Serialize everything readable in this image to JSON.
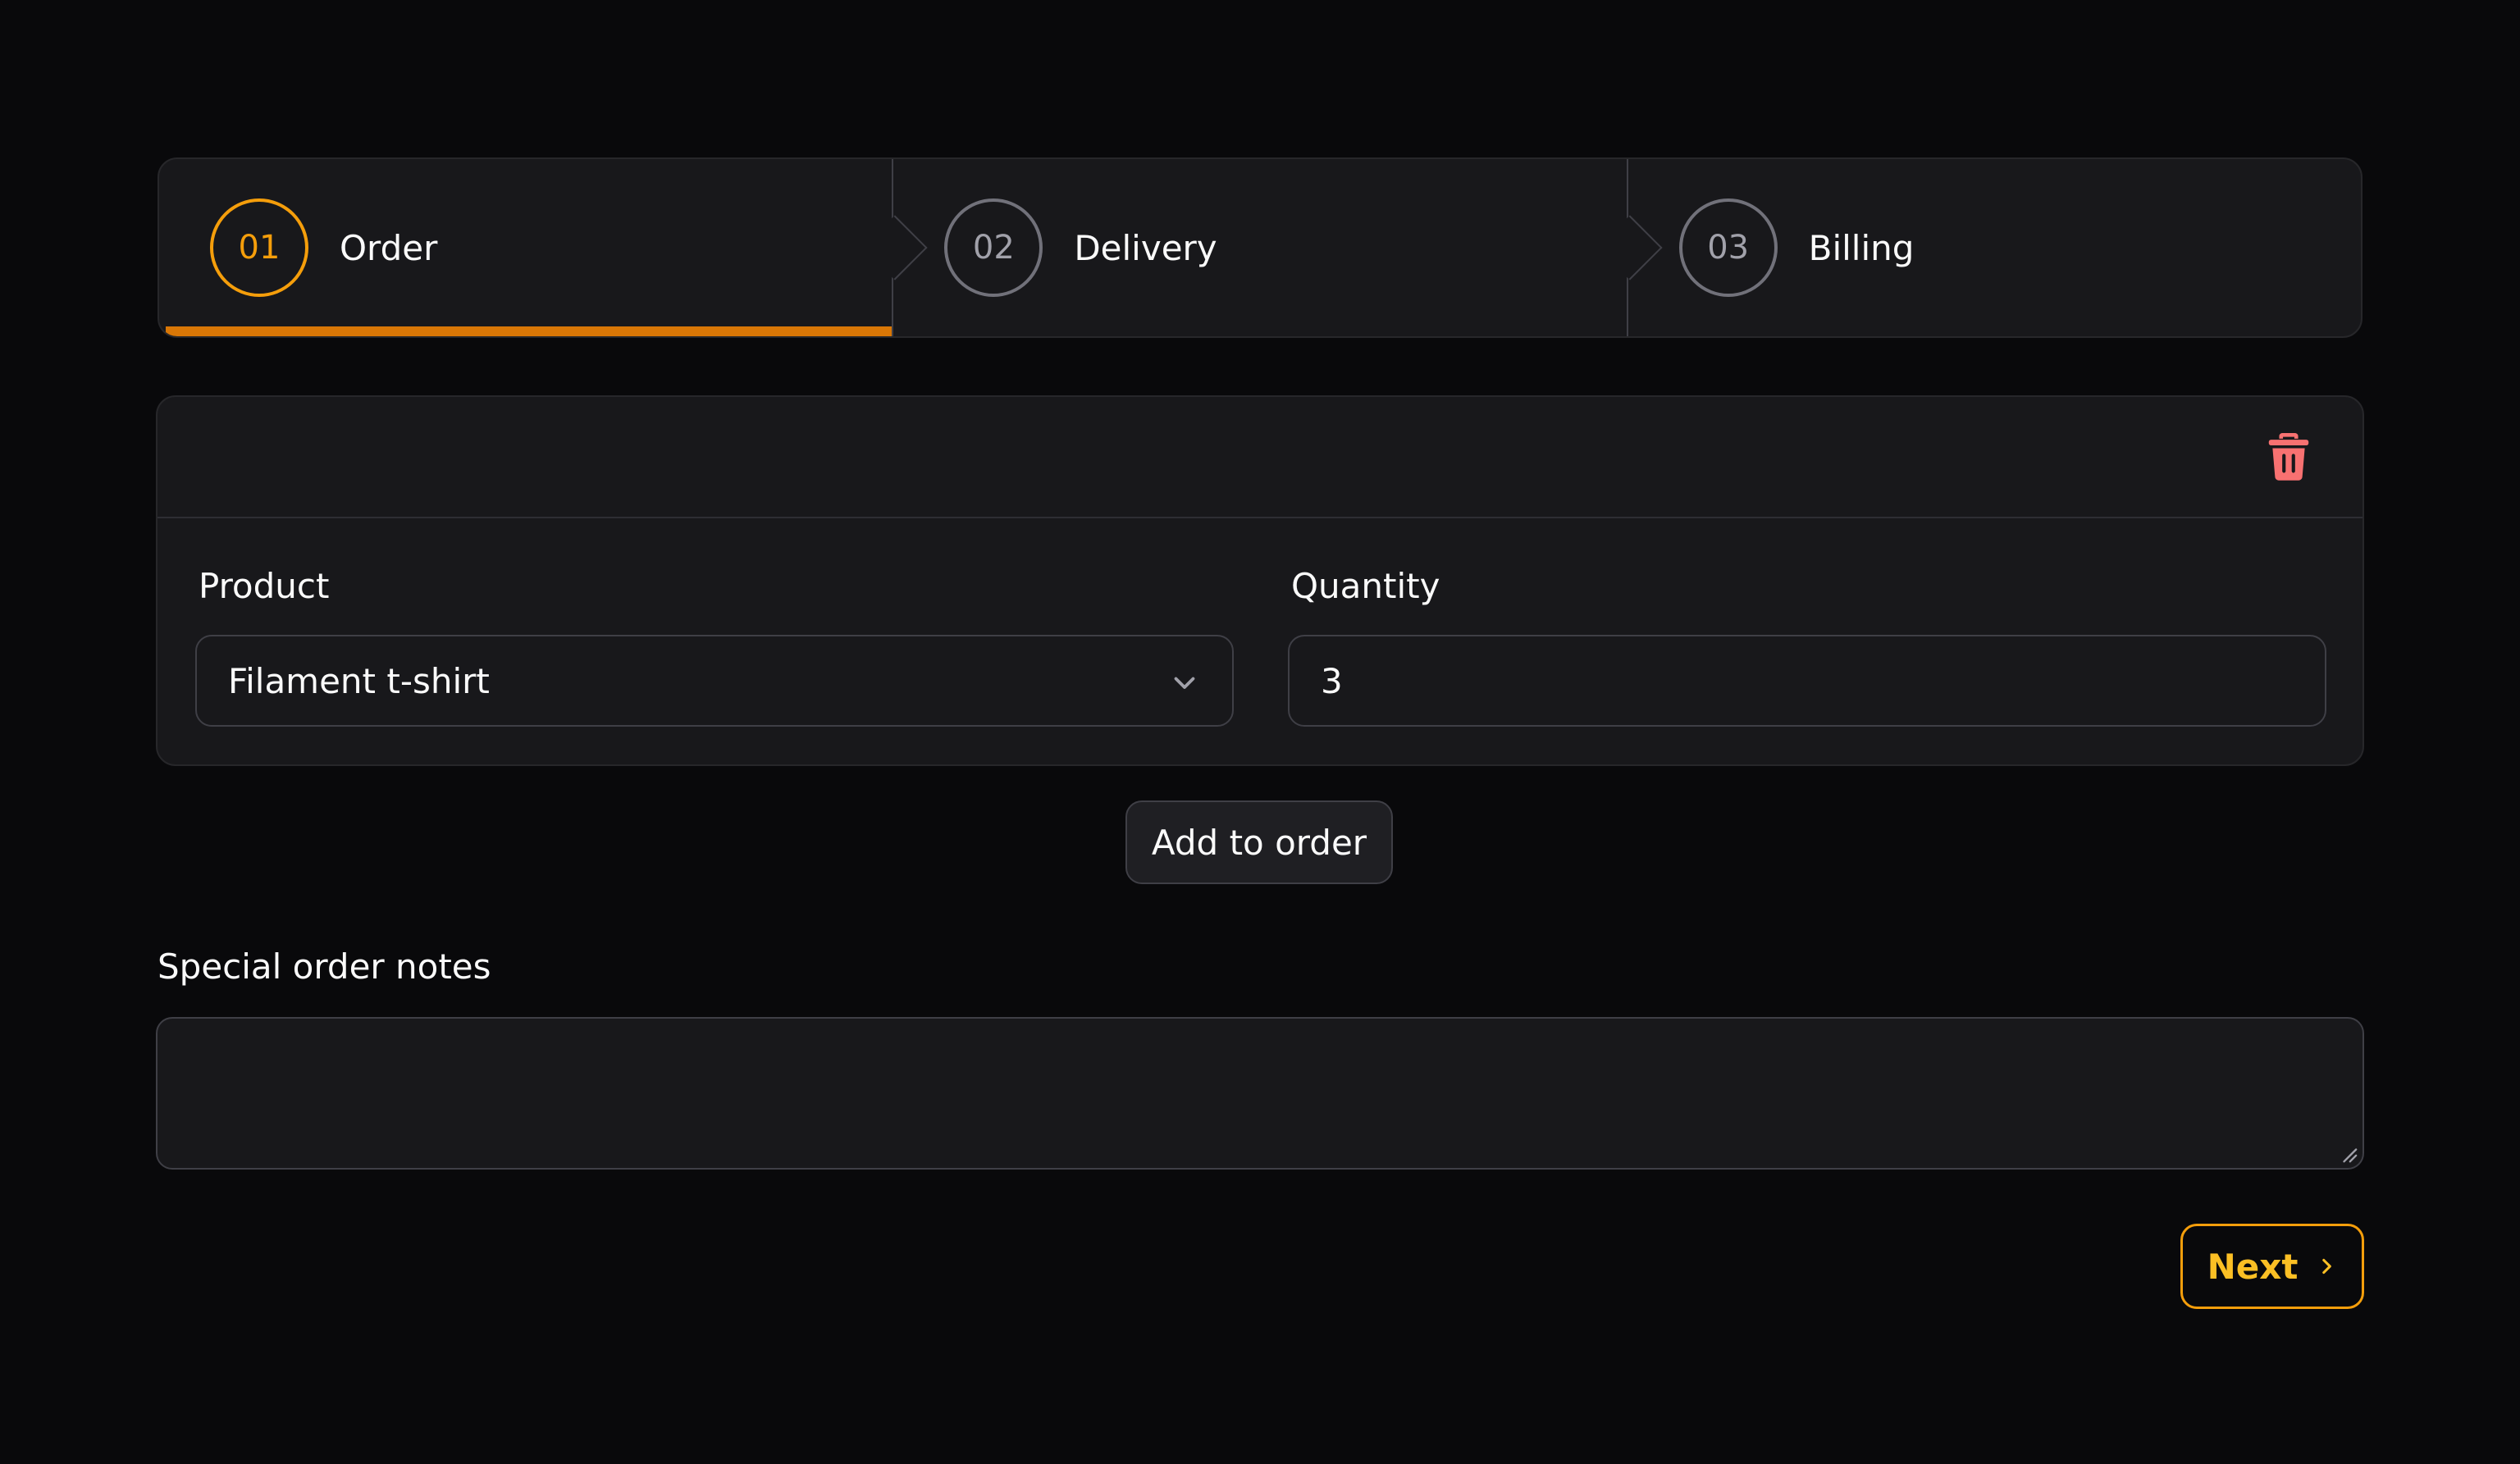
{
  "wizard": {
    "steps": [
      {
        "number": "01",
        "label": "Order",
        "state": "active"
      },
      {
        "number": "02",
        "label": "Delivery",
        "state": "upcoming"
      },
      {
        "number": "03",
        "label": "Billing",
        "state": "upcoming"
      }
    ]
  },
  "order_item": {
    "product": {
      "label": "Product",
      "value": "Filament t-shirt"
    },
    "quantity": {
      "label": "Quantity",
      "value": "3"
    },
    "delete_icon": "trash-icon"
  },
  "add_button": {
    "label": "Add to order"
  },
  "notes": {
    "label": "Special order notes",
    "value": ""
  },
  "next_button": {
    "label": "Next",
    "icon": "chevron-right-icon"
  },
  "colors": {
    "background": "#09090b",
    "surface": "#18181b",
    "accent": "#f59e0b",
    "accent_bar": "#d97706",
    "danger": "#f87171",
    "border": "#3f3f46"
  }
}
